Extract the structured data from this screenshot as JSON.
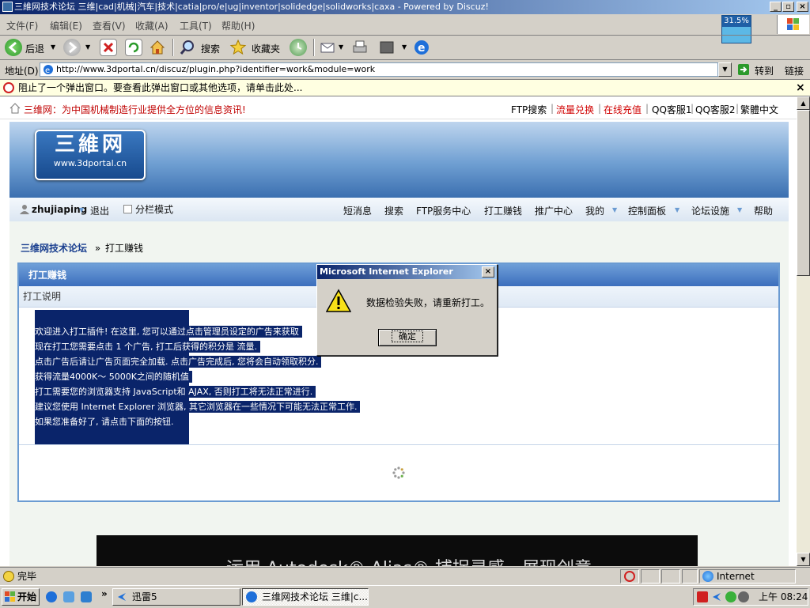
{
  "window": {
    "title": "三維网技术论坛 三维|cad|机械|汽车|技术|catia|pro/e|ug|inventor|solidedge|solidworks|caxa - Powered by Discuz!",
    "controls": [
      "_",
      "▫",
      "×"
    ]
  },
  "cpu_widget": {
    "value": "31.5%"
  },
  "menu": {
    "items": [
      "文件(F)",
      "编辑(E)",
      "查看(V)",
      "收藏(A)",
      "工具(T)",
      "帮助(H)"
    ]
  },
  "toolbar": {
    "back_label": "后退",
    "search_label": "搜索",
    "favorites_label": "收藏夹"
  },
  "address": {
    "label": "地址(D)",
    "url": "http://www.3dportal.cn/discuz/plugin.php?identifier=work&module=work",
    "go_label": "转到",
    "links_label": "链接"
  },
  "popup_blocker": {
    "text": "阻止了一个弹出窗口。要查看此弹出窗口或其他选项，请单击此处..."
  },
  "site": {
    "slogan": "三维网：为中国机械制造行业提供全方位的信息资讯!",
    "top_links": [
      "FTP搜索",
      "流量兑换",
      "在线充值",
      "QQ客服1",
      "QQ客服2",
      "繁體中文"
    ],
    "logo_text": "三維网",
    "logo_url": "www.3dportal.cn",
    "user": {
      "name": "zhujiaping",
      "logout": "退出",
      "split_mode": "分栏模式"
    },
    "nav": [
      "短消息",
      "搜索",
      "FTP服务中心",
      "打工赚钱",
      "推广中心",
      "我的",
      "控制面板",
      "论坛设施",
      "帮助"
    ],
    "breadcrumb": {
      "home": "三维网技术论坛",
      "sep": "»",
      "current": "打工赚钱"
    },
    "panel": {
      "title": "打工赚钱",
      "subtitle": "打工说明",
      "lines": [
        "欢迎进入打工插件! 在这里, 您可以通过点击管理员设定的广告来获取",
        "现在打工您需要点击  1 个广告, 打工后获得的积分是  流量.",
        "点击广告后请让广告页面完全加载. 点击广告完成后, 您将会自动领取积分.",
        "获得流量4000K～ 5000K之间的随机值",
        "打工需要您的浏览器支持  JavaScript和  AJAX, 否则打工将无法正常进行.",
        "建议您使用  Internet Explorer 浏览器, 其它浏览器在一些情况下可能无法正常工作.",
        "如果您准备好了, 请点击下面的按钮."
      ]
    },
    "ad_text": "运用 Autodesk® Alias® 捕捉灵感，展现创意"
  },
  "dialog": {
    "title": "Microsoft Internet Explorer",
    "message": "数据检验失败，请重新打工。",
    "ok_label": "确定"
  },
  "statusbar": {
    "text": "完毕",
    "zone": "Internet"
  },
  "taskbar": {
    "start_label": "开始",
    "tasks": [
      "迅雷5",
      "三维网技术论坛 三维|c..."
    ],
    "clock": "上午 08:24"
  },
  "colors": {
    "slogan": "#c00000",
    "link_red": "#d00000",
    "titlebar": "#0a246a",
    "selection": "#0a246a",
    "panel_border": "#6b9bd2"
  }
}
